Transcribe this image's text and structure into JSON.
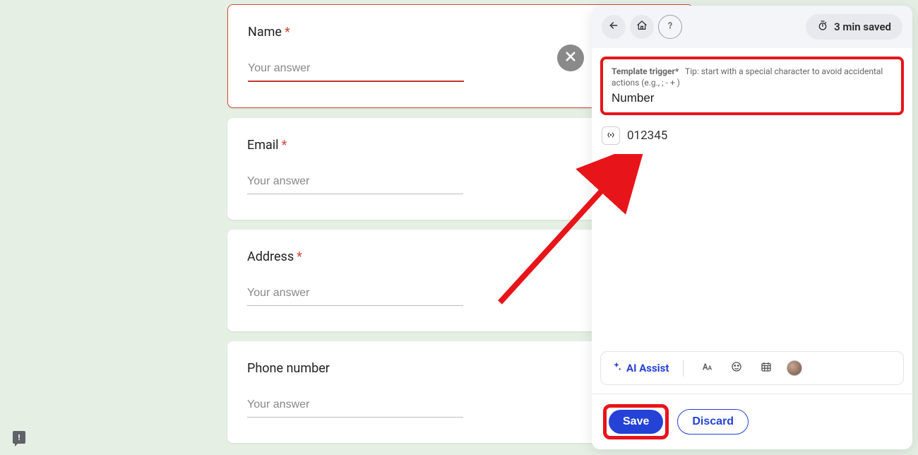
{
  "form": {
    "questions": [
      {
        "label": "Name",
        "required": true,
        "placeholder": "Your answer",
        "active": true
      },
      {
        "label": "Email",
        "required": true,
        "placeholder": "Your answer",
        "active": false
      },
      {
        "label": "Address",
        "required": true,
        "placeholder": "Your answer",
        "active": false
      },
      {
        "label": "Phone number",
        "required": false,
        "placeholder": "Your answer",
        "active": false
      }
    ]
  },
  "panel": {
    "time_saved": "3 min saved",
    "trigger": {
      "label": "Template trigger*",
      "tip": "Tip: start with a special character to avoid accidental actions (e.g., ; - + )",
      "value": "Number"
    },
    "content_value": "012345",
    "ai_assist_label": "AI Assist",
    "save_label": "Save",
    "discard_label": "Discard"
  }
}
